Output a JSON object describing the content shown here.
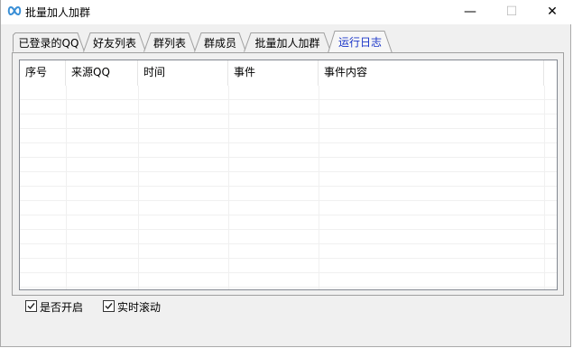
{
  "window": {
    "title": "批量加人加群",
    "minimize_glyph": "—",
    "maximize_glyph": "☐",
    "close_glyph": "✕",
    "app_icon": "infinity-icon"
  },
  "tabs": [
    {
      "label": "已登录的QQ",
      "active": false
    },
    {
      "label": "好友列表",
      "active": false
    },
    {
      "label": "群列表",
      "active": false
    },
    {
      "label": "群成员",
      "active": false
    },
    {
      "label": "批量加人加群",
      "active": false
    },
    {
      "label": "运行日志",
      "active": true
    }
  ],
  "log_table": {
    "columns": [
      "序号",
      "来源QQ",
      "时间",
      "事件",
      "事件内容"
    ],
    "rows": []
  },
  "options": {
    "enable": {
      "label": "是否开启",
      "checked": true
    },
    "autoscroll": {
      "label": "实时滚动",
      "checked": true
    }
  },
  "colors": {
    "active_tab_text": "#1a35c8",
    "window_bg": "#f0f0f0",
    "app_icon": "#3a8fd6"
  }
}
